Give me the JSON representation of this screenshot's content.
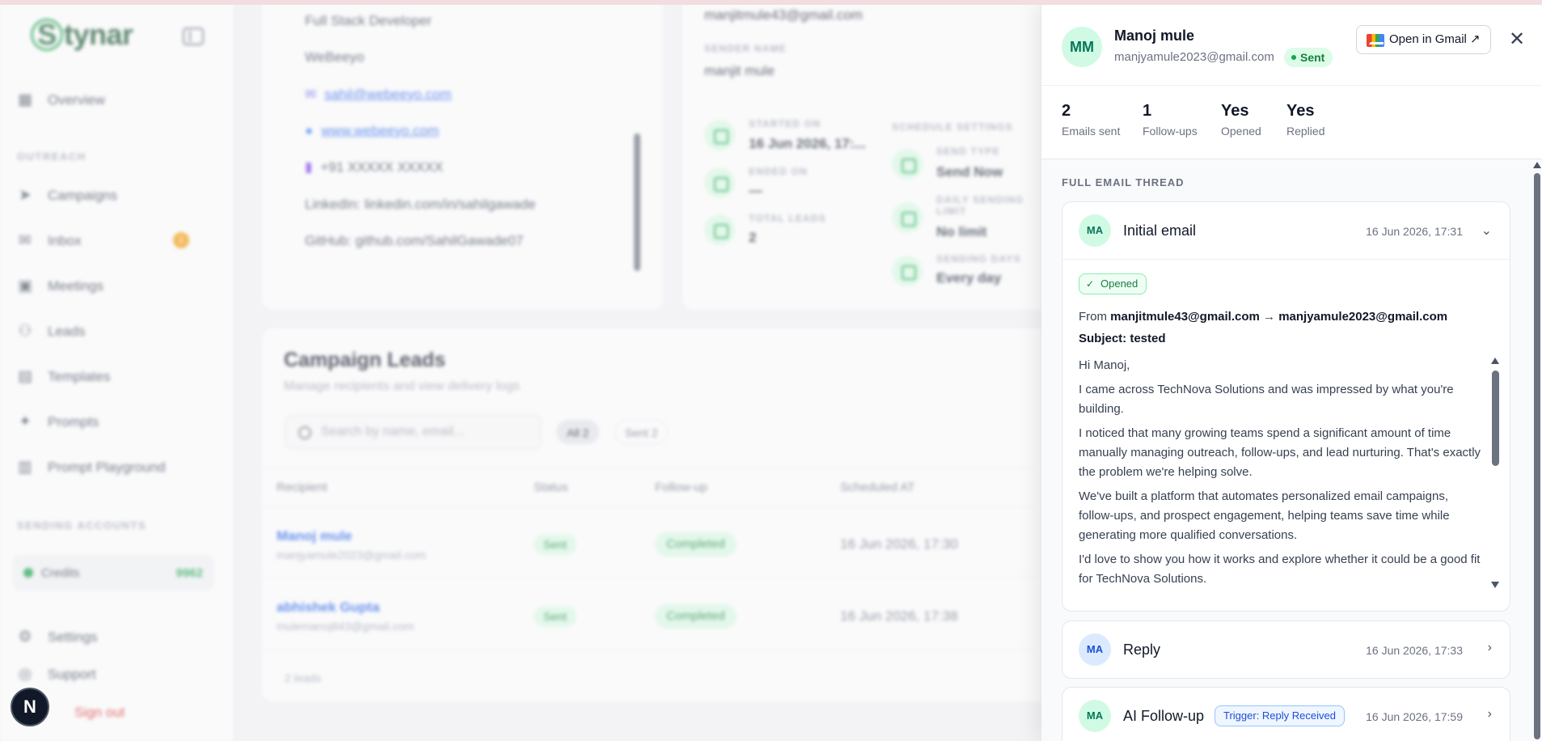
{
  "app": {
    "logo": "Stynar",
    "nav": {
      "overview": "Overview",
      "section_outreach": "OUTREACH",
      "campaigns": "Campaigns",
      "inbox": "Inbox",
      "inbox_badge": "2",
      "meetings": "Meetings",
      "leads": "Leads",
      "templates": "Templates",
      "prompts": "Prompts",
      "prompt_playground": "Prompt Playground",
      "section_sending": "SENDING ACCOUNTS",
      "credits_label": "Credits",
      "credits_value": "9962",
      "settings": "Settings",
      "support": "Support",
      "sign_out": "Sign out"
    },
    "user_badge": "N"
  },
  "signature": {
    "role": "Full Stack Developer",
    "company": "WeBeeyo",
    "email": "sahil@webeeyo.com",
    "website": "www.webeeyo.com",
    "phone": "+91 XXXXX XXXXX",
    "linkedin": "LinkedIn: linkedin.com/in/sahilgawade",
    "github": "GitHub: github.com/SahilGawade07"
  },
  "campaign_info": {
    "sender_email": "manjitmule43@gmail.com",
    "sender_name_label": "SENDER NAME",
    "sender_name": "manjit mule",
    "started_on_label": "STARTED ON",
    "started_on": "16 Jun 2026, 17:...",
    "ended_on_label": "ENDED ON",
    "ended_on": "—",
    "total_leads_label": "TOTAL LEADS",
    "total_leads": "2",
    "schedule_settings_label": "SCHEDULE SETTINGS",
    "send_type_label": "SEND TYPE",
    "send_type": "Send Now",
    "daily_limit_label": "DAILY SENDING LIMIT",
    "daily_limit": "No limit",
    "sending_days_label": "SENDING DAYS",
    "sending_days": "Every day"
  },
  "campaign_leads": {
    "title": "Campaign Leads",
    "subtitle": "Manage recipients and view delivery logs",
    "search_placeholder": "Search by name, email...",
    "filter_all": "All 2",
    "filter_sent": "Sent 2",
    "columns": [
      "Recipient",
      "Status",
      "Follow-up",
      "Scheduled AT"
    ],
    "rows": [
      {
        "name": "Manoj mule",
        "email": "manjyamule2023@gmail.com",
        "status": "Sent",
        "followup": "Completed",
        "scheduled": "16 Jun 2026, 17:30"
      },
      {
        "name": "abhishek Gupta",
        "email": "mulemanoj843@gmail.com",
        "status": "Sent",
        "followup": "Completed",
        "scheduled": "16 Jun 2026, 17:38"
      }
    ],
    "count": "2 leads"
  },
  "drawer": {
    "avatar": "MM",
    "name": "Manoj mule",
    "email": "manjyamule2023@gmail.com",
    "status": "Sent",
    "open_gmail": "Open in Gmail ↗",
    "close": "✕",
    "stats": [
      {
        "value": "2",
        "label": "Emails sent"
      },
      {
        "value": "1",
        "label": "Follow-ups"
      },
      {
        "value": "Yes",
        "label": "Opened"
      },
      {
        "value": "Yes",
        "label": "Replied"
      }
    ],
    "thread_label": "FULL EMAIL THREAD",
    "initial": {
      "avatar": "MA",
      "title": "Initial email",
      "time": "16 Jun 2026, 17:31",
      "opened": "Opened",
      "from_prefix": "From",
      "from": "manjitmule43@gmail.com",
      "arrow": "→",
      "to": "manjyamule2023@gmail.com",
      "subject": "Subject: tested",
      "body": [
        "Hi Manoj,",
        "I came across TechNova Solutions and was impressed by what you're building.",
        "I noticed that many growing teams spend a significant amount of time manually managing outreach, follow-ups, and lead nurturing. That's exactly the problem we're helping solve.",
        "We've built a platform that automates personalized email campaigns, follow-ups, and prospect engagement, helping teams save time while generating more qualified conversations.",
        "I'd love to show you how it works and explore whether it could be a good fit for TechNova Solutions."
      ]
    },
    "reply": {
      "avatar": "MA",
      "title": "Reply",
      "time": "16 Jun 2026, 17:33"
    },
    "followup": {
      "avatar": "MA",
      "title": "AI Follow-up",
      "trigger": "Trigger: Reply Received",
      "time": "16 Jun 2026, 17:59"
    }
  }
}
